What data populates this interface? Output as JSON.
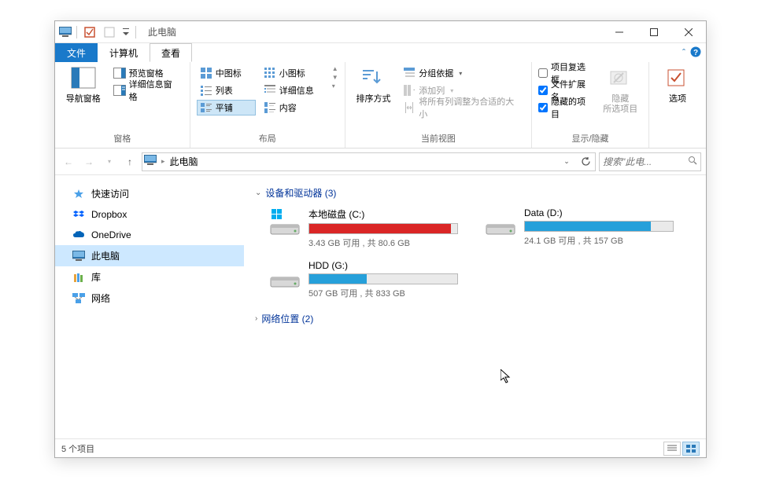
{
  "title": "此电脑",
  "tabs": {
    "file": "文件",
    "computer": "计算机",
    "view": "查看"
  },
  "ribbon": {
    "panes": {
      "nav_pane": "导航窗格",
      "preview_pane": "预览窗格",
      "details_pane": "详细信息窗格",
      "group_label": "窗格"
    },
    "layout": {
      "medium_icons": "中图标",
      "small_icons": "小图标",
      "list": "列表",
      "details": "详细信息",
      "tiles": "平铺",
      "content": "内容",
      "group_label": "布局"
    },
    "current_view": {
      "sort_by": "排序方式",
      "group_by": "分组依据",
      "add_columns": "添加列",
      "size_columns": "将所有列调整为合适的大小",
      "group_label": "当前视图"
    },
    "show_hide": {
      "item_checkboxes": "项目复选框",
      "file_ext": "文件扩展名",
      "hidden_items": "隐藏的项目",
      "hide_selected": "隐藏\n所选项目",
      "group_label": "显示/隐藏"
    },
    "options": "选项"
  },
  "address": {
    "location": "此电脑"
  },
  "search": {
    "placeholder": "搜索\"此电..."
  },
  "sidebar": {
    "quick_access": "快速访问",
    "dropbox": "Dropbox",
    "onedrive": "OneDrive",
    "this_pc": "此电脑",
    "libraries": "库",
    "network": "网络"
  },
  "content": {
    "devices_header": "设备和驱动器 (3)",
    "network_header": "网络位置 (2)",
    "drives": [
      {
        "name": "本地磁盘 (C:)",
        "stats": "3.43 GB 可用 , 共 80.6 GB",
        "used_pct": 96,
        "color": "red",
        "is_os": true
      },
      {
        "name": "Data (D:)",
        "stats": "24.1 GB 可用 , 共 157 GB",
        "used_pct": 85,
        "color": "blue",
        "is_os": false
      },
      {
        "name": "HDD (G:)",
        "stats": "507 GB 可用 , 共 833 GB",
        "used_pct": 39,
        "color": "blue",
        "is_os": false
      }
    ]
  },
  "statusbar": {
    "items": "5 个项目"
  },
  "checkboxes": {
    "item_cb": false,
    "file_ext": true,
    "hidden": true
  }
}
